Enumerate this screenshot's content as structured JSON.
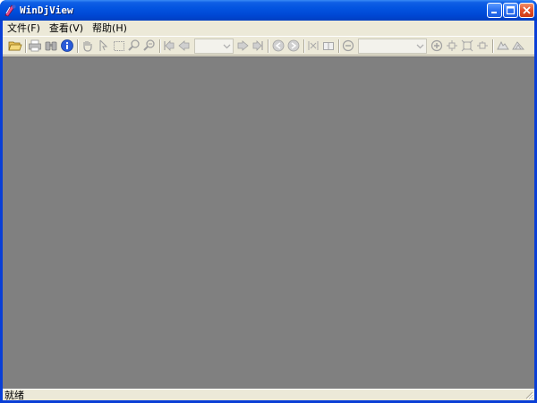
{
  "window": {
    "title": "WinDjView",
    "minimize_icon": "minimize-icon",
    "maximize_icon": "maximize-icon",
    "close_icon": "close-icon"
  },
  "menu": {
    "items": [
      {
        "label": "文件(F)"
      },
      {
        "label": "查看(V)"
      },
      {
        "label": "帮助(H)"
      }
    ]
  },
  "toolbar": {
    "page_combo_value": "",
    "zoom_combo_value": "",
    "icons": [
      "open-icon",
      "print-icon",
      "find-icon",
      "info-icon",
      "hand-icon",
      "text-select-icon",
      "rect-select-icon",
      "zoom-in-icon",
      "zoom-out-icon",
      "first-page-icon",
      "prev-page-icon",
      "next-page-icon",
      "last-page-icon",
      "back-icon",
      "forward-icon",
      "fit-width-icon",
      "fit-page-icon",
      "zoom-out-circle-icon",
      "zoom-in-circle-icon",
      "rotate-left-icon",
      "actual-size-icon",
      "rotate-right-icon",
      "mode-continuous-icon",
      "mode-single-icon"
    ]
  },
  "status": {
    "text": "就绪"
  },
  "colors": {
    "title_bar": "#0354e0",
    "chrome": "#ece9d8",
    "viewport": "#808080"
  }
}
